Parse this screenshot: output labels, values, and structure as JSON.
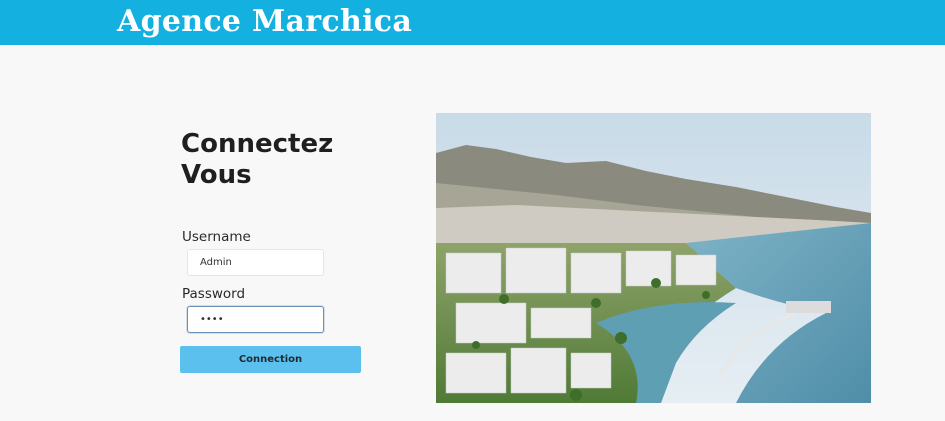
{
  "header": {
    "brand": "Agence Marchica",
    "color": "#14b1e0"
  },
  "login": {
    "title": "Connectez Vous",
    "username_label": "Username",
    "username_value": "Admin",
    "password_label": "Password",
    "password_value": "••••",
    "button_label": "Connection",
    "button_color": "#5cc0ee"
  },
  "hero": {
    "image": "aerial-view-marina-city-photo"
  }
}
